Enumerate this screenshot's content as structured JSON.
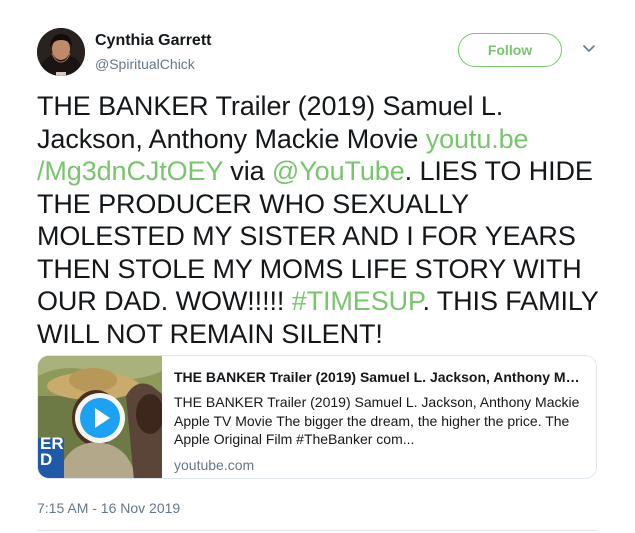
{
  "user": {
    "display_name": "Cynthia Garrett",
    "handle": "@SpiritualChick",
    "avatar_icon": "profile-photo"
  },
  "follow_label": "Follow",
  "caret_icon": "chevron-down-icon",
  "tweet": {
    "text_1": "THE BANKER Trailer (2019) Samuel L. Jackson, Anthony Mackie Movie ",
    "link_1": "youtu.be /Mg3dnCJtOEY",
    "text_2": " via ",
    "link_2": "@YouTube",
    "text_3": ". LIES TO HIDE THE PRODUCER WHO SEXUALLY MOLESTED MY SISTER AND I FOR YEARS THEN STOLE MY MOMS LIFE STORY WITH OUR DAD. WOW!!!!!  ",
    "link_3": "#TIMESUP",
    "text_4": ". THIS FAMILY WILL NOT REMAIN SILENT!"
  },
  "card": {
    "title": "THE BANKER Trailer (2019) Samuel L. Jackson, Anthony Ma...",
    "description": "THE BANKER Trailer (2019) Samuel L. Jackson, Anthony Mackie Apple TV Movie The bigger the dream, the higher the price. The Apple Original Film #TheBanker com...",
    "domain": "youtube.com",
    "thumb_text": "ER\nD",
    "play_icon": "play-icon"
  },
  "timestamp": "7:15 AM - 16 Nov 2019",
  "colors": {
    "accent": "#77c66b",
    "text": "#14171a",
    "secondary": "#657786",
    "border": "#e1e8ed"
  }
}
